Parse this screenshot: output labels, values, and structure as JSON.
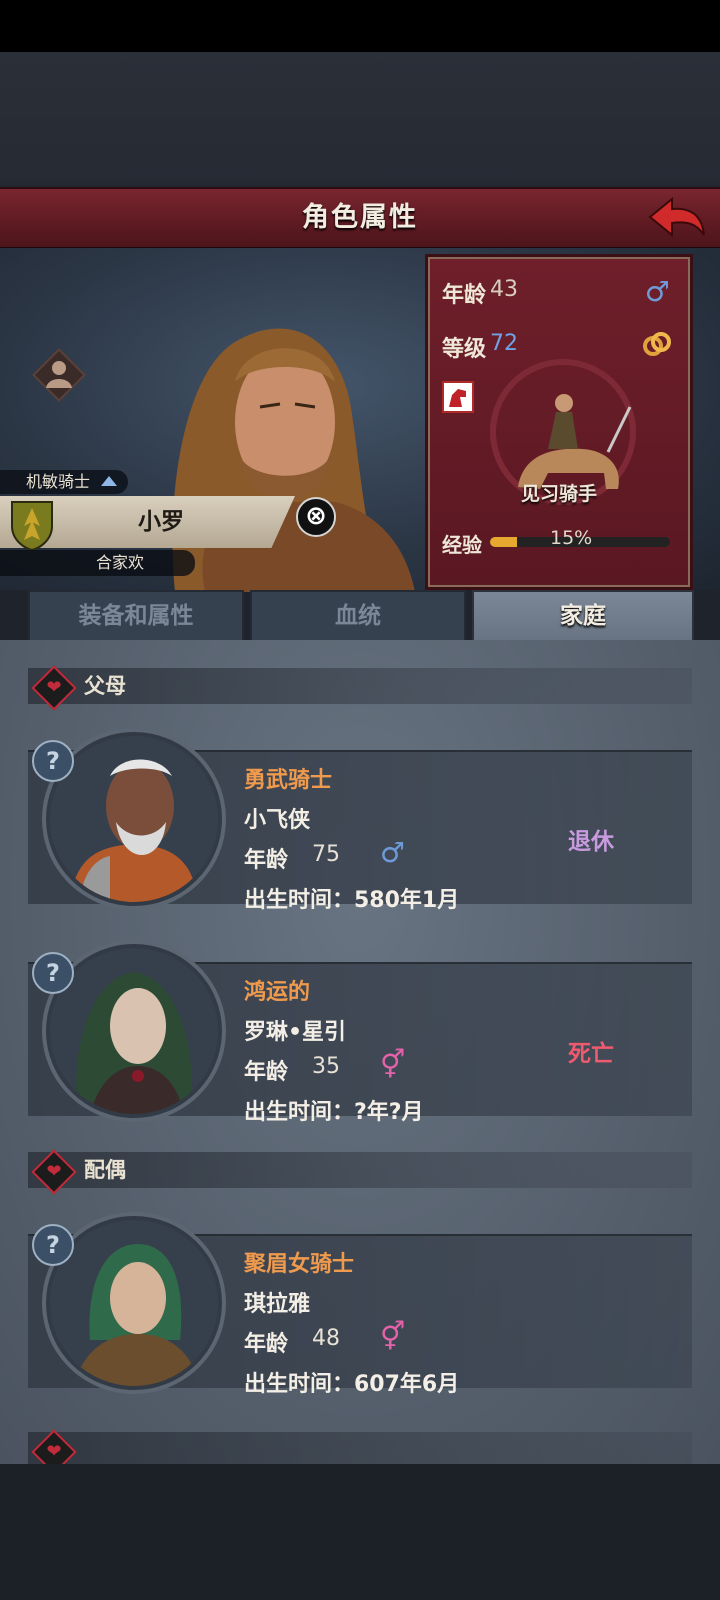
{
  "header": {
    "title": "角色属性"
  },
  "hero": {
    "class_title": "机敏骑士",
    "name": "小罗",
    "house": "合家欢",
    "age_label": "年龄",
    "age": "43",
    "gender_symbol": "♂",
    "level_label": "等级",
    "level": "72",
    "rank": "见习骑手",
    "exp_label": "经验",
    "exp_percent": "15%",
    "exp_fraction": 0.15,
    "dismiss_symbol": "⊗"
  },
  "tabs": [
    {
      "label": "装备和属性",
      "active": false
    },
    {
      "label": "血统",
      "active": false
    },
    {
      "label": "家庭",
      "active": true
    }
  ],
  "sections": [
    {
      "label": "父母"
    },
    {
      "label": "配偶"
    }
  ],
  "family": [
    {
      "title": "勇武骑士",
      "name": "小飞侠",
      "age_label": "年龄",
      "age": "75",
      "sex": "♂",
      "sex_color": "#6f9ad8",
      "birth": "出生时间：580年1月",
      "status": "退休",
      "status_color": "#c89be0",
      "help": "?"
    },
    {
      "title": "鸿运的",
      "name": "罗琳•星引",
      "age_label": "年龄",
      "age": "35",
      "sex": "⚥",
      "sex_color": "#e263a8",
      "birth": "出生时间：?年?月",
      "status": "死亡",
      "status_color": "#f05a6e",
      "help": "?"
    },
    {
      "title": "聚眉女骑士",
      "name": "琪拉雅",
      "age_label": "年龄",
      "age": "48",
      "sex": "⚥",
      "sex_color": "#e263a8",
      "birth": "出生时间：607年6月",
      "status": "",
      "status_color": "#f05a6e",
      "help": "?"
    }
  ],
  "colors": {
    "accent_red": "#6e1f2a",
    "title_orange": "#ef9a4d",
    "level_blue": "#6fa2e6"
  }
}
